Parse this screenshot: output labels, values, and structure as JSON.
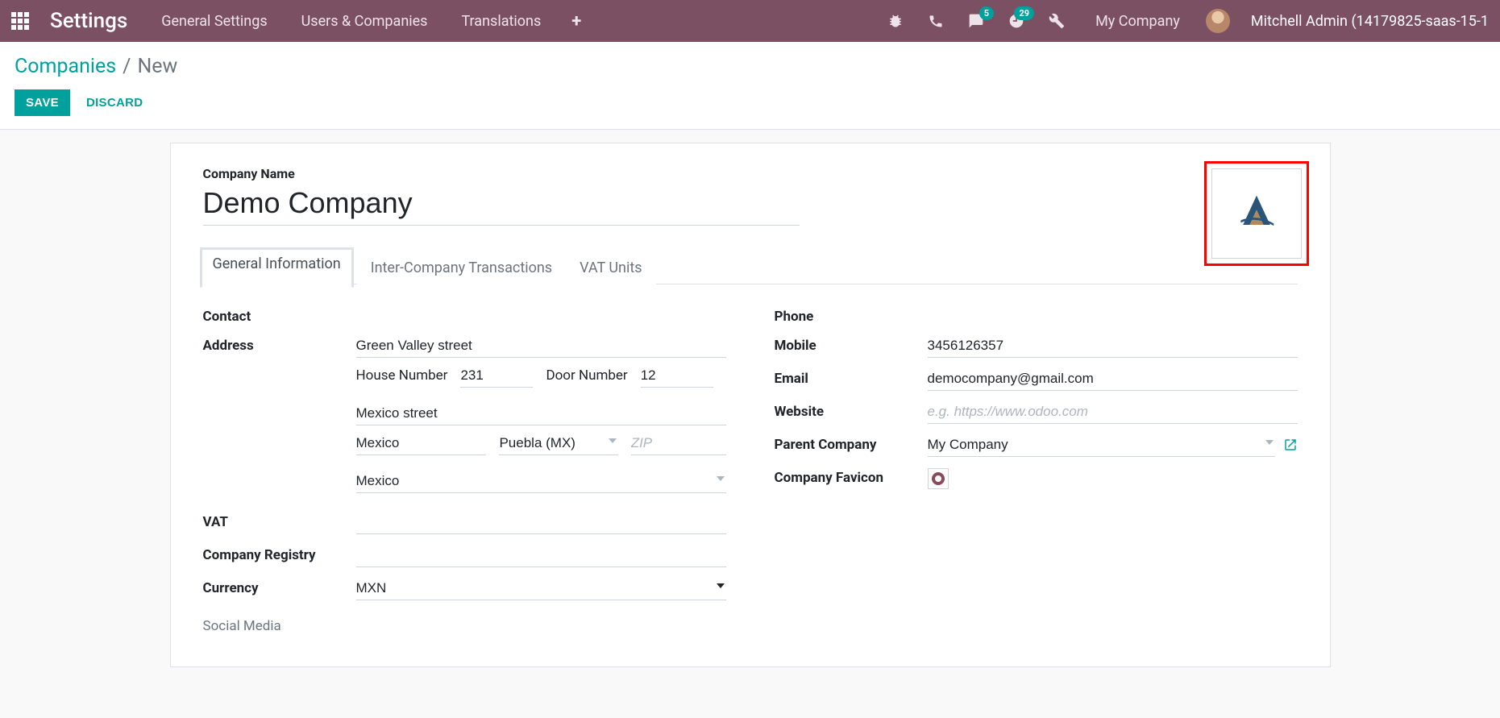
{
  "topbar": {
    "brand": "Settings",
    "nav": [
      "General Settings",
      "Users & Companies",
      "Translations"
    ],
    "messages_badge": "5",
    "activities_badge": "29",
    "company": "My Company",
    "user": "Mitchell Admin (14179825-saas-15-1"
  },
  "breadcrumb": {
    "root": "Companies",
    "sep": "/",
    "current": "New"
  },
  "actions": {
    "save": "SAVE",
    "discard": "DISCARD"
  },
  "form": {
    "company_name_label": "Company Name",
    "company_name_value": "Demo Company",
    "tabs": [
      "General Information",
      "Inter-Company Transactions",
      "VAT Units"
    ],
    "left": {
      "contact_label": "Contact",
      "address_label": "Address",
      "address": {
        "street": "Green Valley street",
        "house_number_label": "House Number",
        "house_number": "231",
        "door_number_label": "Door Number",
        "door_number": "12",
        "street2": "Mexico street",
        "city": "Mexico",
        "state": "Puebla (MX)",
        "zip_placeholder": "ZIP",
        "zip": "",
        "country": "Mexico"
      },
      "vat_label": "VAT",
      "vat_value": "",
      "registry_label": "Company Registry",
      "registry_value": "",
      "currency_label": "Currency",
      "currency_value": "MXN",
      "social_media_heading": "Social Media"
    },
    "right": {
      "phone_label": "Phone",
      "phone_value": "",
      "mobile_label": "Mobile",
      "mobile_value": "3456126357",
      "email_label": "Email",
      "email_value": "democompany@gmail.com",
      "website_label": "Website",
      "website_placeholder": "e.g. https://www.odoo.com",
      "website_value": "",
      "parent_label": "Parent Company",
      "parent_value": "My Company",
      "favicon_label": "Company Favicon"
    }
  }
}
